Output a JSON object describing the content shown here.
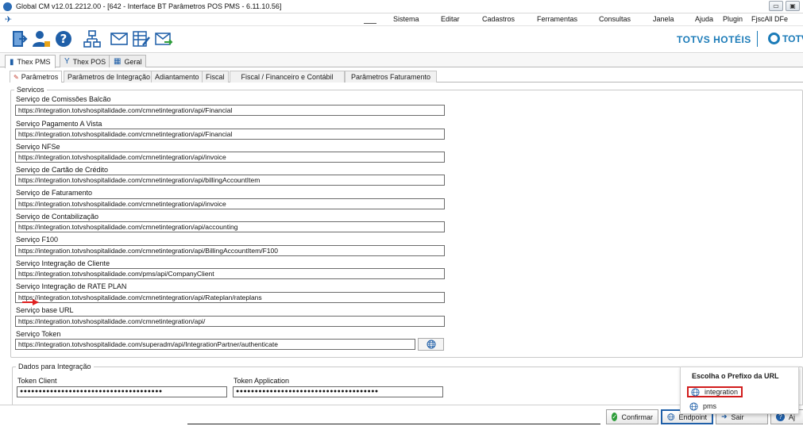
{
  "window": {
    "title": "Global CM v12.01.2212.00 - [642 - Interface BT Parâmetros POS PMS - 6.11.10.56]",
    "controls": [
      "▭",
      "▣"
    ]
  },
  "menu": {
    "items": [
      "Sistema",
      "Editar",
      "Cadastros",
      "Ferramentas",
      "Consultas",
      "Janela",
      "Ajuda",
      "Plugin",
      "FjscAll DFe"
    ]
  },
  "brand": {
    "primary": "TOTVS HOTÉIS",
    "secondary": "TOTV",
    "color": "#1b7bb8"
  },
  "tabs": [
    {
      "label": "Thex PMS",
      "icon": "pms-icon"
    },
    {
      "label": "Thex POS",
      "icon": "pos-icon"
    },
    {
      "label": "Geral",
      "icon": "config-icon"
    }
  ],
  "subtabs": [
    "Parâmetros",
    "Parâmetros de Integração",
    "Adiantamento",
    "Fiscal",
    "Fiscal / Financeiro e Contábil",
    "Parâmetros Faturamento"
  ],
  "services": {
    "legend": "Servicos",
    "fields": [
      {
        "label": "Serviço de Comissões Balcão",
        "value": "https://integration.totvshospitalidade.com/cmnetintegration/api/Financial"
      },
      {
        "label": "Serviço Pagamento A Vista",
        "value": "https://integration.totvshospitalidade.com/cmnetintegration/api/Financial"
      },
      {
        "label": "Serviço NFSe",
        "value": "https://integration.totvshospitalidade.com/cmnetintegration/api/invoice"
      },
      {
        "label": "Serviço de Cartão de Crédito",
        "value": "https://integration.totvshospitalidade.com/cmnetintegration/api/billingAccountItem"
      },
      {
        "label": "Serviço de Faturamento",
        "value": "https://integration.totvshospitalidade.com/cmnetintegration/api/invoice"
      },
      {
        "label": "Serviço de Contabilização",
        "value": "https://integration.totvshospitalidade.com/cmnetintegration/api/accounting"
      },
      {
        "label": "Serviço F100",
        "value": "https://integration.totvshospitalidade.com/cmnetintegration/api/BillingAccountItem/F100"
      },
      {
        "label": "Serviço Integração de Cliente",
        "value": "https://integration.totvshospitalidade.com/pms/api/CompanyClient"
      },
      {
        "label": "Serviço Integração de RATE PLAN",
        "value": "https://integration.totvshospitalidade.com/cmnetintegration/api/Rateplan/rateplans"
      },
      {
        "label": "Serviço base URL",
        "value": "https://integration.totvshospitalidade.com/cmnetintegration/api/"
      },
      {
        "label": "Serviço Token",
        "value": "https://integration.totvshospitalidade.com/superadm/api/IntegrationPartner/authenticate"
      }
    ]
  },
  "integration": {
    "legend": "Dados para Integração",
    "token_client_label": "Token Client",
    "token_client_value": "●●●●●●●●●●●●●●●●●●●●●●●●●●●●●●●●●●●●●●",
    "token_app_label": "Token Application",
    "token_app_value": "●●●●●●●●●●●●●●●●●●●●●●●●●●●●●●●●●●●●●●"
  },
  "popup": {
    "title": "Escolha o Prefixo da URL",
    "options": [
      "integration",
      "pms"
    ],
    "selected": "integration",
    "highlight_color": "#d11c1c"
  },
  "buttons": {
    "confirm": "Confirmar",
    "endpoint": "Endpoint",
    "exit": "Sair",
    "help": "Aj"
  }
}
